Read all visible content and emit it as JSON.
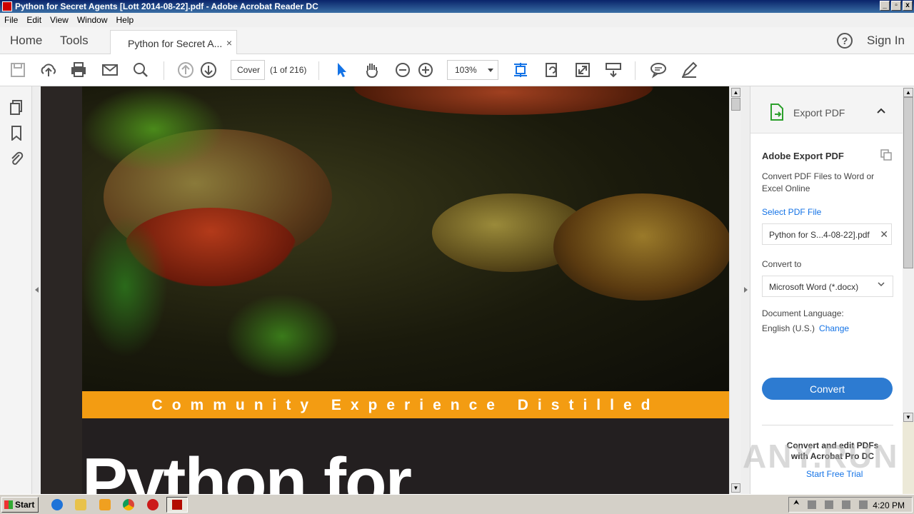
{
  "window": {
    "title": "Python for Secret Agents [Lott 2014-08-22].pdf - Adobe Acrobat Reader DC",
    "minimize": "_",
    "maximize": "▫",
    "close": "x"
  },
  "menu": [
    "File",
    "Edit",
    "View",
    "Window",
    "Help"
  ],
  "tabs": {
    "home": "Home",
    "tools": "Tools",
    "document": "Python for Secret A...",
    "close": "×"
  },
  "header": {
    "help": "?",
    "sign_in": "Sign In"
  },
  "toolbar": {
    "page_field": "Cover",
    "page_count": "(1 of 216)",
    "zoom": "103%",
    "icons": [
      "save-icon",
      "upload-icon",
      "print-icon",
      "email-icon",
      "search-icon",
      "page-up-icon",
      "page-down-icon",
      "select-cursor-icon",
      "hand-icon",
      "zoom-out-icon",
      "zoom-in-icon",
      "fit-page-icon",
      "rotate-icon",
      "full-screen-icon",
      "scroll-mode-icon",
      "comment-icon",
      "sign-icon"
    ]
  },
  "document": {
    "banner": "Community Experience Distilled",
    "title": "Python for"
  },
  "right_pane": {
    "header": "Export PDF",
    "title": "Adobe Export PDF",
    "description": "Convert PDF Files to Word or Excel Online",
    "select_file_label": "Select PDF File",
    "file_name": "Python for S...4-08-22].pdf",
    "convert_to_label": "Convert to",
    "format": "Microsoft Word (*.docx)",
    "doc_language_label": "Document Language:",
    "language": "English (U.S.)",
    "change_link": "Change",
    "convert_button": "Convert",
    "promo": "Convert and edit PDFs with Acrobat Pro DC",
    "trial_link": "Start Free Trial"
  },
  "watermark": "ANY.RUN",
  "taskbar": {
    "start": "Start",
    "clock": "4:20 PM"
  },
  "colors": {
    "banner": "#f39c12",
    "accent": "#1473e6",
    "convert": "#2d7bd1"
  }
}
